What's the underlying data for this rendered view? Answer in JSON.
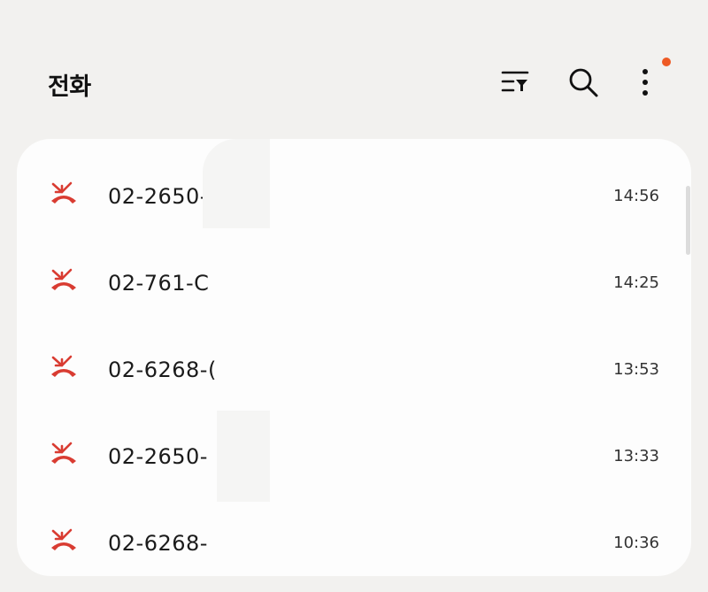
{
  "header": {
    "title": "전화",
    "icons": [
      "filter-icon",
      "search-icon",
      "more-options-icon"
    ],
    "notification_color": "#ee5a24"
  },
  "call_log": [
    {
      "number": "02-2650-",
      "time": "14:56",
      "type": "missed-call-icon"
    },
    {
      "number": "02-761-C",
      "time": "14:25",
      "type": "missed-call-icon"
    },
    {
      "number": "02-6268-(",
      "time": "13:53",
      "type": "missed-call-icon"
    },
    {
      "number": "02-2650-",
      "time": "13:33",
      "type": "missed-call-icon"
    },
    {
      "number": "02-6268-",
      "time": "10:36",
      "type": "missed-call-icon"
    }
  ],
  "colors": {
    "missed_call": "#d93c32",
    "background": "#f2f1ef",
    "card": "#fdfdfd"
  }
}
